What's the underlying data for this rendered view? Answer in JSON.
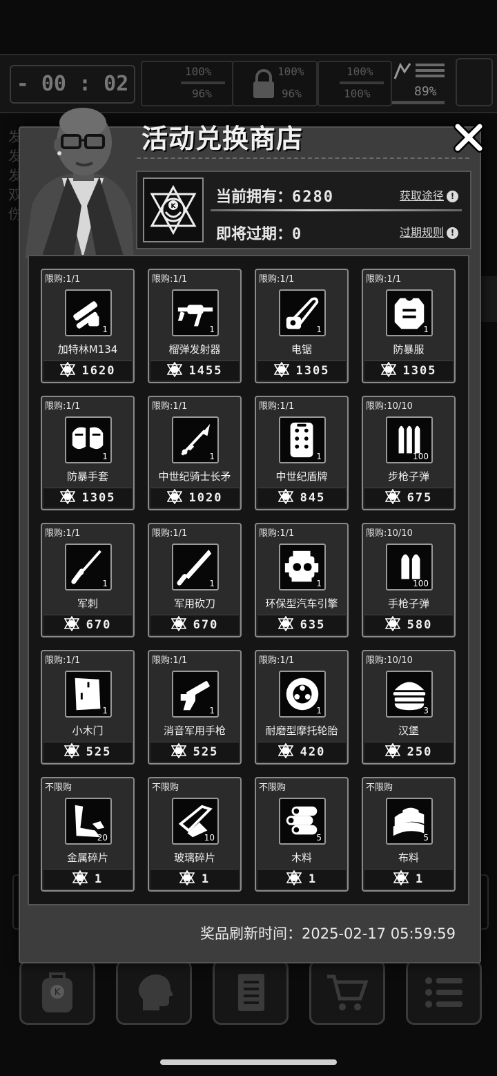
{
  "background": {
    "timer": "- 00 : 02 -",
    "stats": [
      {
        "top": "100%",
        "bottom": "96%"
      },
      {
        "top": "100%",
        "bottom": "96%"
      },
      {
        "top": "100%",
        "bottom": "100%"
      }
    ],
    "battery_percent": "89%",
    "side_text": [
      "发",
      "发",
      "发",
      "双",
      "伤"
    ]
  },
  "shop": {
    "title": "活动兑换商店",
    "owned_label": "当前拥有：",
    "owned_value": "6280",
    "expiring_label": "即将过期：",
    "expiring_value": "0",
    "obtain_link": "获取途径",
    "expiry_rules_link": "过期规则",
    "info_glyph": "!",
    "refresh_label": "奖品刷新时间：",
    "refresh_time": "2025-02-17 05:59:59",
    "items": [
      {
        "limit": "限购:1/1",
        "name": "加特林M134",
        "qty": "1",
        "price": "1620",
        "icon": "minigun-icon"
      },
      {
        "limit": "限购:1/1",
        "name": "榴弹发射器",
        "qty": "1",
        "price": "1455",
        "icon": "grenade-launcher-icon"
      },
      {
        "limit": "限购:1/1",
        "name": "电锯",
        "qty": "1",
        "price": "1305",
        "icon": "chainsaw-icon"
      },
      {
        "limit": "限购:1/1",
        "name": "防暴服",
        "qty": "1",
        "price": "1305",
        "icon": "riot-armor-icon"
      },
      {
        "limit": "限购:1/1",
        "name": "防暴手套",
        "qty": "1",
        "price": "1305",
        "icon": "riot-gloves-icon"
      },
      {
        "limit": "限购:1/1",
        "name": "中世纪骑士长矛",
        "qty": "1",
        "price": "1020",
        "icon": "lance-icon"
      },
      {
        "limit": "限购:1/1",
        "name": "中世纪盾牌",
        "qty": "1",
        "price": "845",
        "icon": "shield-icon"
      },
      {
        "limit": "限购:10/10",
        "name": "步枪子弹",
        "qty": "100",
        "price": "675",
        "icon": "rifle-ammo-icon"
      },
      {
        "limit": "限购:1/1",
        "name": "军刺",
        "qty": "1",
        "price": "670",
        "icon": "bayonet-icon"
      },
      {
        "limit": "限购:1/1",
        "name": "军用砍刀",
        "qty": "1",
        "price": "670",
        "icon": "machete-icon"
      },
      {
        "limit": "限购:1/1",
        "name": "环保型汽车引擎",
        "qty": "1",
        "price": "635",
        "icon": "engine-icon"
      },
      {
        "limit": "限购:10/10",
        "name": "手枪子弹",
        "qty": "100",
        "price": "580",
        "icon": "pistol-ammo-icon"
      },
      {
        "limit": "限购:1/1",
        "name": "小木门",
        "qty": "1",
        "price": "525",
        "icon": "wooden-door-icon"
      },
      {
        "limit": "限购:1/1",
        "name": "消音军用手枪",
        "qty": "1",
        "price": "525",
        "icon": "silenced-pistol-icon"
      },
      {
        "limit": "限购:1/1",
        "name": "耐磨型摩托轮胎",
        "qty": "1",
        "price": "420",
        "icon": "tire-icon"
      },
      {
        "limit": "限购:10/10",
        "name": "汉堡",
        "qty": "3",
        "price": "250",
        "icon": "burger-icon"
      },
      {
        "limit": "不限购",
        "name": "金属碎片",
        "qty": "20",
        "price": "1",
        "icon": "metal-scrap-icon"
      },
      {
        "limit": "不限购",
        "name": "玻璃碎片",
        "qty": "10",
        "price": "1",
        "icon": "glass-shard-icon"
      },
      {
        "limit": "不限购",
        "name": "木料",
        "qty": "5",
        "price": "1",
        "icon": "wood-logs-icon"
      },
      {
        "limit": "不限购",
        "name": "布料",
        "qty": "5",
        "price": "1",
        "icon": "cloth-icon"
      }
    ]
  },
  "colors": {
    "modal_bg": "#3d3d3d",
    "card_bg": "#2b2b2b",
    "accent_white": "#f2f2f2"
  }
}
